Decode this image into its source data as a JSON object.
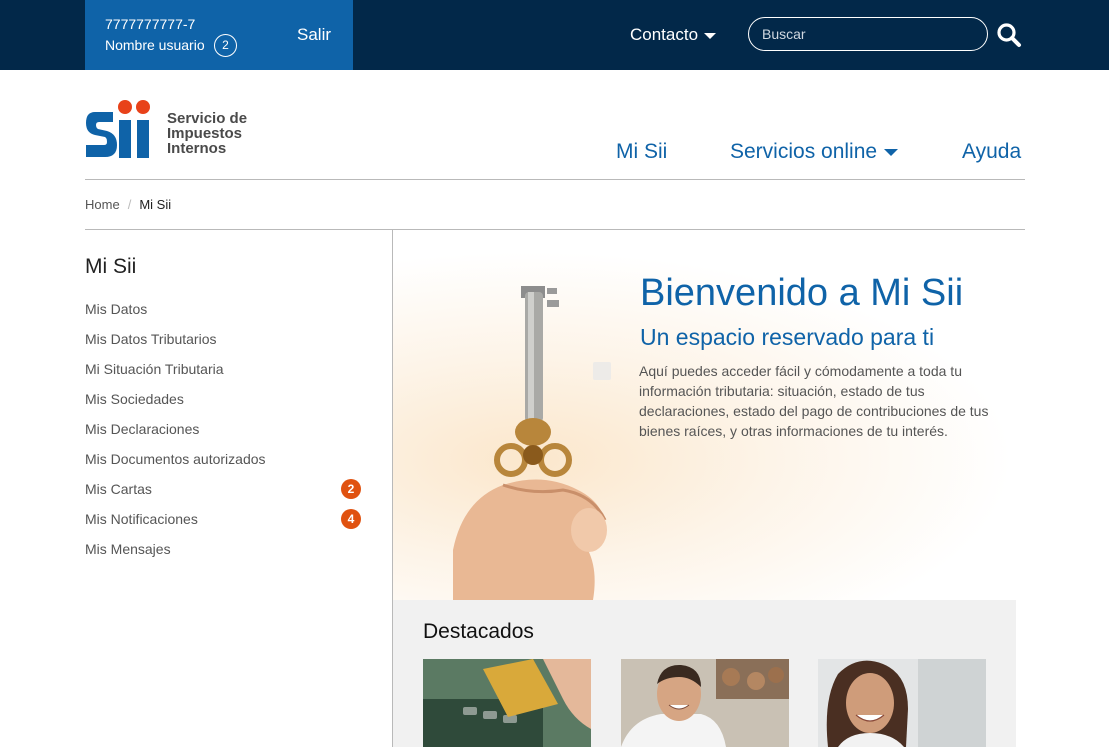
{
  "topbar": {
    "user_rut": "7777777777-7",
    "user_name": "Nombre usuario",
    "user_count": "2",
    "logout_label": "Salir",
    "contact_label": "Contacto",
    "search_placeholder": "Buscar",
    "search_icon": "search-icon"
  },
  "header": {
    "logo_text_line1": "Servicio de",
    "logo_text_line2": "Impuestos",
    "logo_text_line3": "Internos",
    "nav": {
      "mi_sii": "Mi Sii",
      "servicios": "Servicios online",
      "ayuda": "Ayuda"
    }
  },
  "breadcrumb": {
    "home": "Home",
    "separator": "/",
    "current": "Mi Sii"
  },
  "sidebar": {
    "title": "Mi Sii",
    "items": [
      {
        "label": "Mis Datos"
      },
      {
        "label": "Mis Datos Tributarios"
      },
      {
        "label": "Mi Situación Tributaria"
      },
      {
        "label": "Mis Sociedades"
      },
      {
        "label": "Mis Declaraciones"
      },
      {
        "label": "Mis Documentos autorizados"
      },
      {
        "label": "Mis Cartas",
        "badge": "2"
      },
      {
        "label": "Mis Notificaciones",
        "badge": "4"
      },
      {
        "label": "Mis Mensajes"
      }
    ]
  },
  "hero": {
    "title": "Bienvenido a Mi Sii",
    "subtitle": "Un espacio reservado para ti",
    "text": "Aquí puedes acceder fácil y cómodamente a toda tu información tributaria: situación, estado de tus declaraciones, estado del pago de contribuciones de tus bienes raíces, y otras informaciones de tu interés."
  },
  "featured": {
    "title": "Destacados"
  },
  "colors": {
    "topbar_bg": "#022849",
    "brand_blue": "#0f63a8",
    "badge_orange": "#e05210",
    "logo_red": "#e8421a"
  }
}
